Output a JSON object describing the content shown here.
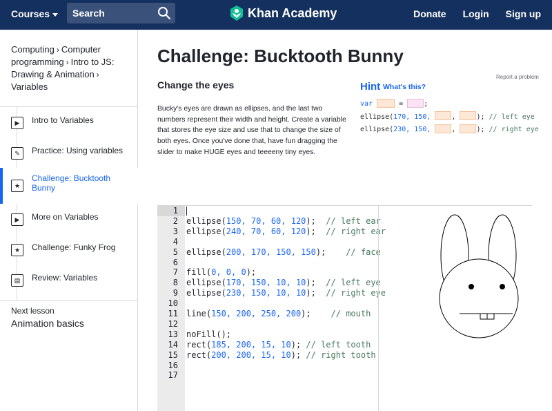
{
  "topbar": {
    "courses_label": "Courses",
    "search_label": "Search",
    "logo_text": "Khan Academy",
    "donate": "Donate",
    "login": "Login",
    "signup": "Sign up"
  },
  "sidebar": {
    "breadcrumb": [
      "Computing",
      "Computer programming",
      "Intro to JS: Drawing & Animation",
      "Variables"
    ],
    "items": [
      {
        "label": "Intro to Variables",
        "icon": "play-icon"
      },
      {
        "label": "Practice: Using variables",
        "icon": "pencil-icon"
      },
      {
        "label": "Challenge: Bucktooth Bunny",
        "icon": "star-icon"
      },
      {
        "label": "More on Variables",
        "icon": "play-icon"
      },
      {
        "label": "Challenge: Funky Frog",
        "icon": "star-icon"
      },
      {
        "label": "Review: Variables",
        "icon": "document-icon"
      }
    ],
    "next_lesson_label": "Next lesson",
    "next_lesson_title": "Animation basics"
  },
  "main": {
    "title": "Challenge: Bucktooth Bunny",
    "report": "Report a problem",
    "subtitle": "Change the eyes",
    "description": "Bucky's eyes are drawn as ellipses, and the last two numbers represent their width and height. Create a variable that stores the eye size and use that to change the size of both eyes. Once you've done that, have fun dragging the slider to make HUGE eyes and teeeeny tiny eyes."
  },
  "hint": {
    "title": "Hint",
    "link": "What's this?",
    "line1_kw": "var",
    "line1_eq": "=",
    "line1_end": ";",
    "line2_start": "ellipse(",
    "line2_nums": "170, 150,",
    "line2_comment": "// left eye",
    "line3_start": "ellipse(",
    "line3_nums": "230, 150,",
    "line3_comment": "// right eye",
    "comma": ",",
    "close": ");"
  },
  "editor": {
    "line_numbers": [
      "1",
      "2",
      "3",
      "4",
      "5",
      "6",
      "7",
      "8",
      "9",
      "10",
      "11",
      "12",
      "13",
      "14",
      "15",
      "16",
      "17"
    ],
    "lines": [
      {
        "code": "",
        "nums": "",
        "comment": ""
      },
      {
        "code": "ellipse(",
        "nums": "150, 70, 60, 120",
        "tail": ");  ",
        "comment": "// left ear"
      },
      {
        "code": "ellipse(",
        "nums": "240, 70, 60, 120",
        "tail": ");  ",
        "comment": "// right ear"
      },
      {
        "code": "",
        "nums": "",
        "comment": ""
      },
      {
        "code": "ellipse(",
        "nums": "200, 170, 150, 150",
        "tail": ");    ",
        "comment": "// face"
      },
      {
        "code": "",
        "nums": "",
        "comment": ""
      },
      {
        "code": "fill(",
        "nums": "0, 0, 0",
        "tail": ");",
        "comment": ""
      },
      {
        "code": "ellipse(",
        "nums": "170, 150, 10, 10",
        "tail": ");  ",
        "comment": "// left eye"
      },
      {
        "code": "ellipse(",
        "nums": "230, 150, 10, 10",
        "tail": ");  ",
        "comment": "// right eye"
      },
      {
        "code": "",
        "nums": "",
        "comment": ""
      },
      {
        "code": "line(",
        "nums": "150, 200, 250, 200",
        "tail": ");    ",
        "comment": "// mouth"
      },
      {
        "code": "",
        "nums": "",
        "comment": ""
      },
      {
        "code": "noFill();",
        "nums": "",
        "tail": "",
        "comment": ""
      },
      {
        "code": "rect(",
        "nums": "185, 200, 15, 10",
        "tail": "); ",
        "comment": "// left tooth"
      },
      {
        "code": "rect(",
        "nums": "200, 200, 15, 10",
        "tail": "); ",
        "comment": "// right tooth"
      },
      {
        "code": "",
        "nums": "",
        "comment": ""
      },
      {
        "code": "",
        "nums": "",
        "comment": ""
      }
    ]
  },
  "colors": {
    "nav_bg": "#14305e",
    "accent": "#1865f2",
    "comment": "#49795e"
  }
}
